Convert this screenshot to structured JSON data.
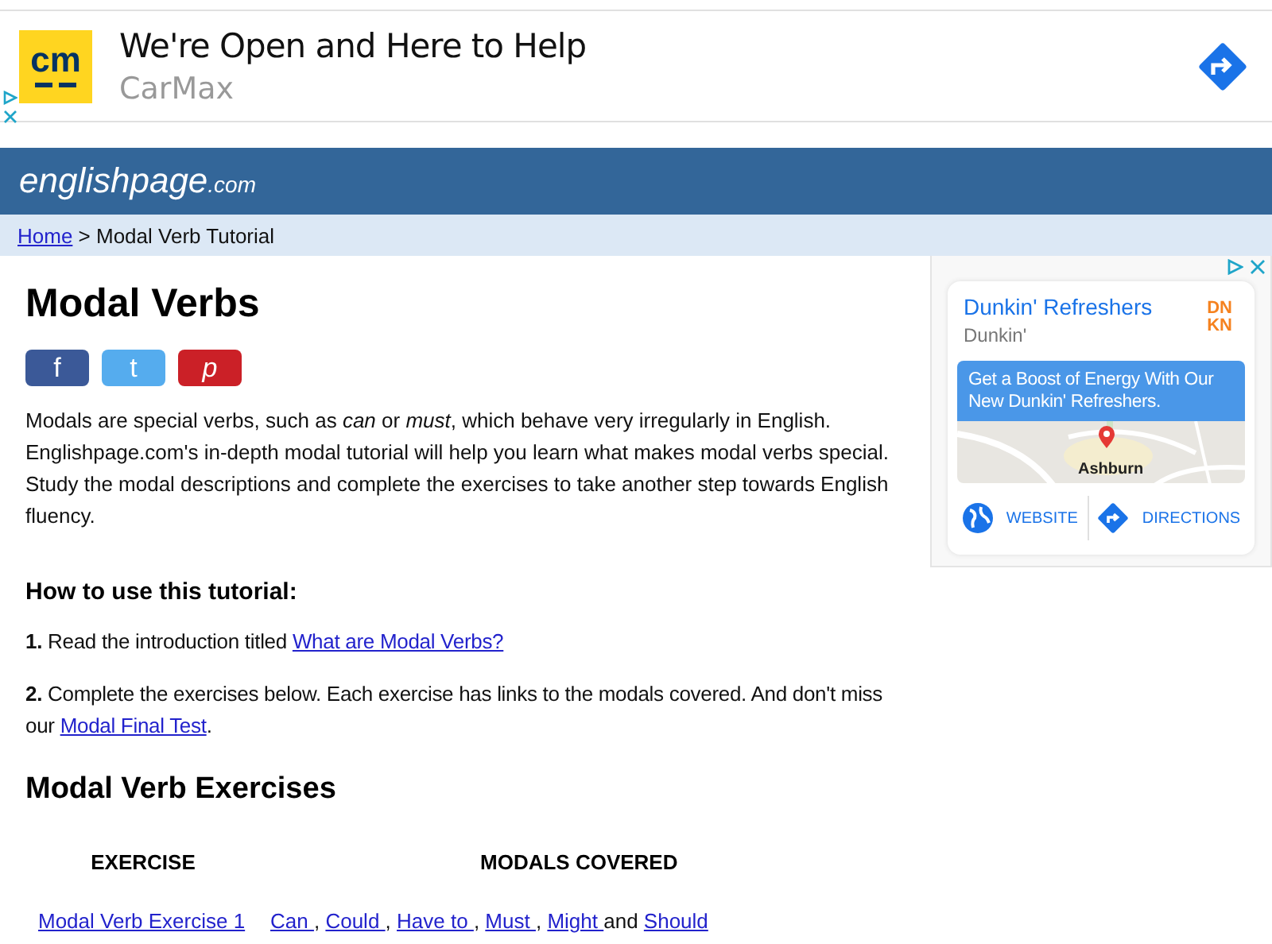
{
  "top_ad": {
    "logo": "cm",
    "headline": "We're Open and Here to Help",
    "advertiser": "CarMax"
  },
  "site": {
    "name": "englishpage",
    "suffix": ".com"
  },
  "breadcrumb": {
    "home": "Home",
    "separator": ">",
    "current": "Modal Verb Tutorial"
  },
  "title": "Modal Verbs",
  "share_buttons": [
    {
      "kind": "facebook",
      "label": "f"
    },
    {
      "kind": "twitter",
      "label": "t"
    },
    {
      "kind": "pinterest",
      "label": "p"
    }
  ],
  "intro": "Modals are special verbs, such as *can* or *must*, which behave very irregularly in English. Englishpage.com's in-depth modal tutorial will help you learn what makes modal verbs special. Study the modal descriptions and complete the exercises to take another step towards English fluency.",
  "howto_heading": "How to use this tutorial:",
  "steps": [
    {
      "number": "1.",
      "text": "Read the introduction titled ",
      "link": "What are Modal Verbs?"
    },
    {
      "number": "2.",
      "text": "Complete the exercises below. Each exercise has links to the modals covered. And don't miss our ",
      "link": "Modal Final Test",
      "after": "."
    }
  ],
  "exercises_heading": "Modal Verb Exercises",
  "table": {
    "columns": [
      "EXERCISE",
      "MODALS COVERED"
    ],
    "rows": [
      {
        "exercise": "Modal Verb Exercise 1",
        "modals": [
          {
            "label": "Can ",
            "sep": ","
          },
          {
            "label": "Could ",
            "sep": ","
          },
          {
            "label": "Have to ",
            "sep": ","
          },
          {
            "label": "Must ",
            "sep": ","
          },
          {
            "label": "Might ",
            "sep": "and"
          },
          {
            "label": "Should"
          }
        ]
      }
    ]
  },
  "side_ad": {
    "headline": "Dunkin' Refreshers",
    "advertiser": "Dunkin'",
    "logo_top": "DN",
    "logo_bottom": "KN",
    "banner": "Get a Boost of Energy With Our New Dunkin' Refreshers.",
    "map_label": "Ashburn",
    "actions": [
      {
        "kind": "website",
        "label": "WEBSITE"
      },
      {
        "kind": "directions",
        "label": "DIRECTIONS"
      }
    ]
  }
}
